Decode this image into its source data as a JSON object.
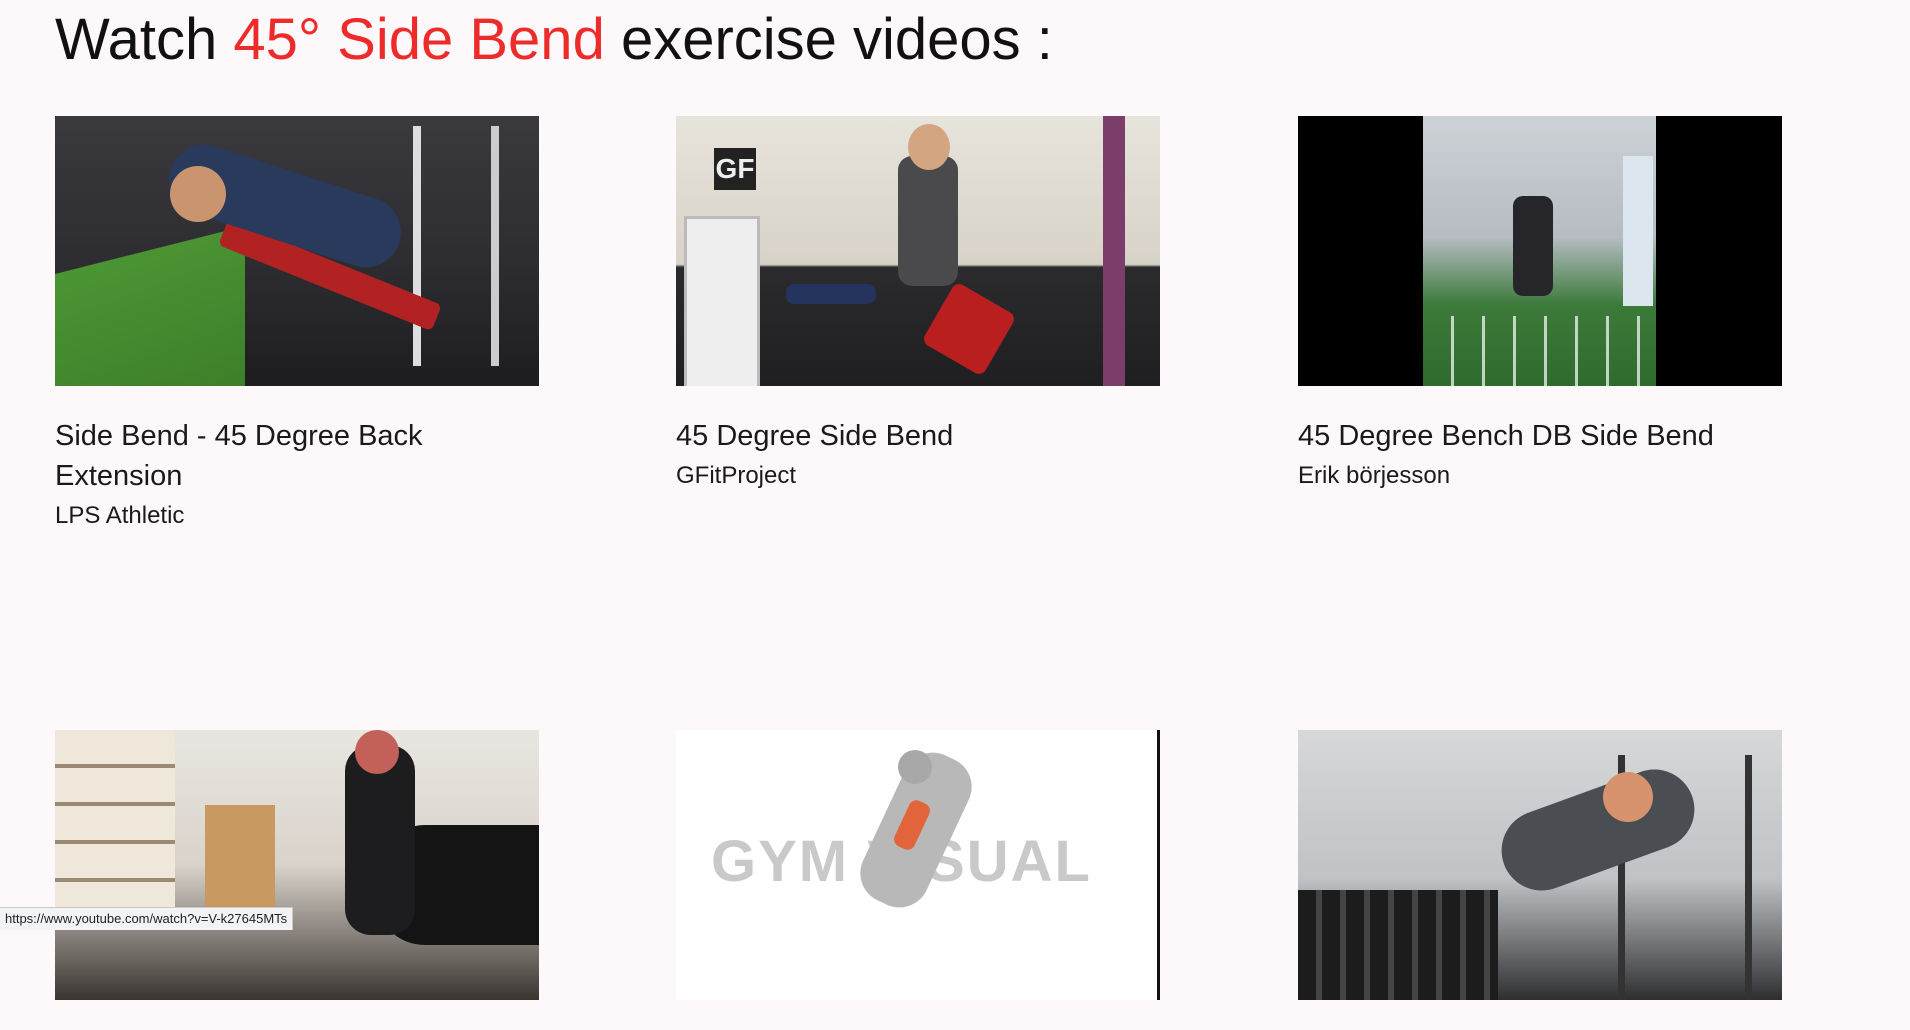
{
  "heading": {
    "prefix": "Watch ",
    "highlight": "45° Side Bend",
    "suffix": " exercise videos :"
  },
  "colors": {
    "highlight": "#ee2b2b",
    "background": "#fdf9fa"
  },
  "videos": [
    {
      "title": "Side Bend - 45 Degree Back Extension",
      "channel": "LPS Athletic"
    },
    {
      "title": "45 Degree Side Bend",
      "channel": "GFitProject"
    },
    {
      "title": "45 Degree Bench DB Side Bend",
      "channel": "Erik börjesson"
    },
    {
      "title": "",
      "channel": ""
    },
    {
      "title": "",
      "channel": ""
    },
    {
      "title": "",
      "channel": ""
    }
  ],
  "thumbnail_text": {
    "gfit_logo": "GF",
    "gym_visual_watermark": "GYM VISUAL"
  },
  "status_bar": {
    "url": "https://www.youtube.com/watch?v=V-k27645MTs"
  }
}
